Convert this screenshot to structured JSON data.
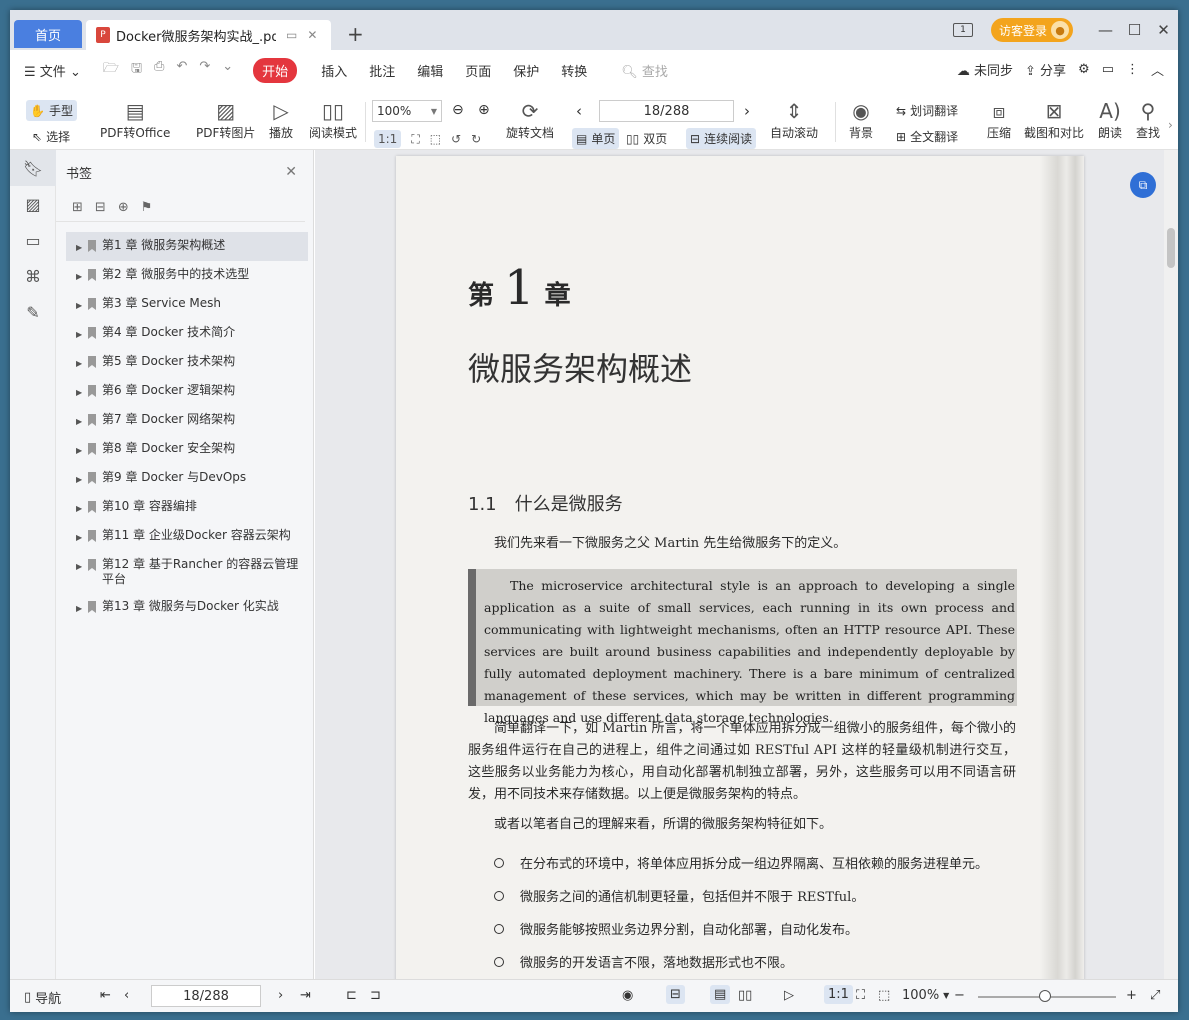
{
  "titlebar": {
    "home_tab": "首页",
    "doc_tab": "Docker微服务架构实战_.pdf",
    "guest_login": "访客登录"
  },
  "menu": {
    "file": "文件",
    "items": [
      "开始",
      "插入",
      "批注",
      "编辑",
      "页面",
      "保护",
      "转换"
    ],
    "search": "查找",
    "sync": "未同步",
    "share": "分享"
  },
  "ribbon": {
    "hand": "手型",
    "select": "选择",
    "pdf_to_office": "PDF转Office",
    "pdf_to_image": "PDF转图片",
    "play": "播放",
    "read_mode": "阅读模式",
    "zoom": "100%",
    "page": "18/288",
    "rotate_doc": "旋转文档",
    "single": "单页",
    "double": "双页",
    "continuous": "连续阅读",
    "auto_scroll": "自动滚动",
    "background": "背景",
    "word_translate": "划词翻译",
    "full_translate": "全文翻译",
    "compress": "压缩",
    "screenshot_compare": "截图和对比",
    "read_aloud": "朗读",
    "find": "查找"
  },
  "bookmarks": {
    "title": "书签",
    "items": [
      "第1 章 微服务架构概述",
      "第2 章 微服务中的技术选型",
      "第3 章 Service Mesh",
      "第4 章 Docker 技术简介",
      "第5 章 Docker 技术架构",
      "第6 章 Docker 逻辑架构",
      "第7 章 Docker 网络架构",
      "第8 章 Docker 安全架构",
      "第9 章 Docker 与DevOps",
      "第10 章 容器编排",
      "第11 章 企业级Docker 容器云架构",
      "第12 章 基于Rancher 的容器云管理平台",
      "第13 章 微服务与Docker 化实战"
    ]
  },
  "page": {
    "chapter_prefix": "第",
    "chapter_num": "1",
    "chapter_suffix": "章",
    "chapter_title": "微服务架构概述",
    "section": "1.1　什么是微服务",
    "intro": "我们先来看一下微服务之父 Martin 先生给微服务下的定义。",
    "quote": "The microservice architectural style is an approach to developing a single application as a suite of small services, each running in its own process and communicating with lightweight mechanisms, often an HTTP resource API. These services are built around business capabilities and independently deployable by fully automated deployment machinery. There is a bare minimum of centralized management of these services, which may be written in different programming languages and use different data storage technologies.",
    "para1": "简单翻译一下，如 Martin 所言，将一个单体应用拆分成一组微小的服务组件，每个微小的服务组件运行在自己的进程上，组件之间通过如 RESTful API 这样的轻量级机制进行交互， 这些服务以业务能力为核心，用自动化部署机制独立部署，另外，这些服务可以用不同语言研发，用不同技术来存储数据。以上便是微服务架构的特点。",
    "para2": "或者以笔者自己的理解来看，所谓的微服务架构特征如下。",
    "bullets": [
      "在分布式的环境中，将单体应用拆分成一组边界隔离、互相依赖的服务进程单元。",
      "微服务之间的通信机制更轻量，包括但并不限于 RESTful。",
      "微服务能够按照业务边界分割，自动化部署，自动化发布。",
      "微服务的开发语言不限，落地数据形式也不限。"
    ]
  },
  "status": {
    "nav": "导航",
    "page": "18/288",
    "zoom": "100%"
  }
}
